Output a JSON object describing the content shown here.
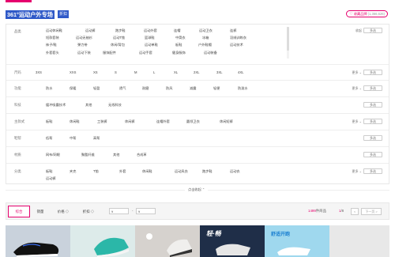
{
  "header": {
    "store_title": "361°运动户外专场",
    "tag": "折扣",
    "collect_label": "收藏品牌",
    "collect_count": "(1,366,626)"
  },
  "filters": [
    {
      "label": "品类",
      "options": [
        "运动休闲鞋",
        "运动裤",
        "跑步鞋",
        "运动外套",
        "连帽",
        "运动卫衣",
        "连裤",
        "短款套装",
        "运动无袖衫",
        "运动T恤",
        "篮球鞋",
        "中筒衣",
        "冰箱",
        "羽绒训练衣",
        "袜子/鞋",
        "弹力带",
        "休闲/背包",
        "运动单鞋",
        "板鞋",
        "户外鞋帽",
        "运动技术",
        "外套套头",
        "运动下装",
        "服饰配件",
        "运动手套",
        "健身服饰",
        "运动装备"
      ],
      "more": "",
      "multi": "多选",
      "extra": "收起"
    },
    {
      "label": "尺码",
      "options": [
        "3XS",
        "XXS",
        "XS",
        "S",
        "M",
        "L",
        "XL",
        "2XL",
        "3XL",
        "4XL"
      ],
      "more": "更多",
      "multi": "多选"
    },
    {
      "label": "功能",
      "options": [
        "防水",
        "保暖",
        "轻盈",
        "透气",
        "耐磨",
        "防风",
        "减震",
        "轻便",
        "防泼水"
      ],
      "more": "更多",
      "multi": "多选"
    },
    {
      "label": "科技",
      "options": [
        "缓冲吸震技术",
        "其他",
        "无线科技"
      ],
      "more": "",
      "multi": "多选"
    },
    {
      "label": "主款式",
      "options": [
        "板鞋",
        "休闲鞋",
        "工装裤",
        "休闲裤",
        "连帽外套",
        "圆领卫衣",
        "休闲短裤"
      ],
      "more": "更多",
      "multi": "多选"
    },
    {
      "label": "鞋帮",
      "options": [
        "低帮",
        "中帮",
        "高帮"
      ],
      "more": "",
      "multi": "多选"
    },
    {
      "label": "材质",
      "options": [
        "网布/网眼",
        "聚酯纤维",
        "其他",
        "合成革"
      ],
      "more": "",
      "multi": "多选"
    },
    {
      "label": "分类",
      "options": [
        "板鞋",
        "夹克",
        "T恤",
        "外套",
        "休闲鞋",
        "运动风衣",
        "跑步鞋",
        "运动衣",
        "运动裤"
      ],
      "more": "更多",
      "multi": "多选"
    }
  ],
  "fold_label": "点击收起 ⌃",
  "sort": {
    "tabs": [
      "综合",
      "销量",
      "价格 ◇",
      "折扣 ◇"
    ],
    "price_min": "¥",
    "price_dash": "-",
    "price_max": "¥",
    "result_count": "1499",
    "result_suffix": "件商品",
    "page_current": "1",
    "page_total": "/8",
    "prev": "<",
    "next": "下一页 >"
  },
  "colors": {
    "accent": "#e5006d",
    "title_bg": "#2f59c8"
  },
  "products": [
    {
      "name": "product-1",
      "bg": "#c9d2dc"
    },
    {
      "name": "product-2",
      "bg": "#ddebea"
    },
    {
      "name": "product-3",
      "bg": "#d6d2ce"
    },
    {
      "name": "product-4",
      "bg": "#1f2e48"
    },
    {
      "name": "product-5",
      "bg": "#9fd8ee"
    },
    {
      "name": "product-6",
      "bg": "#e8e8e8"
    }
  ],
  "product_banners": [
    "轻·畅",
    "舒适开跑"
  ]
}
